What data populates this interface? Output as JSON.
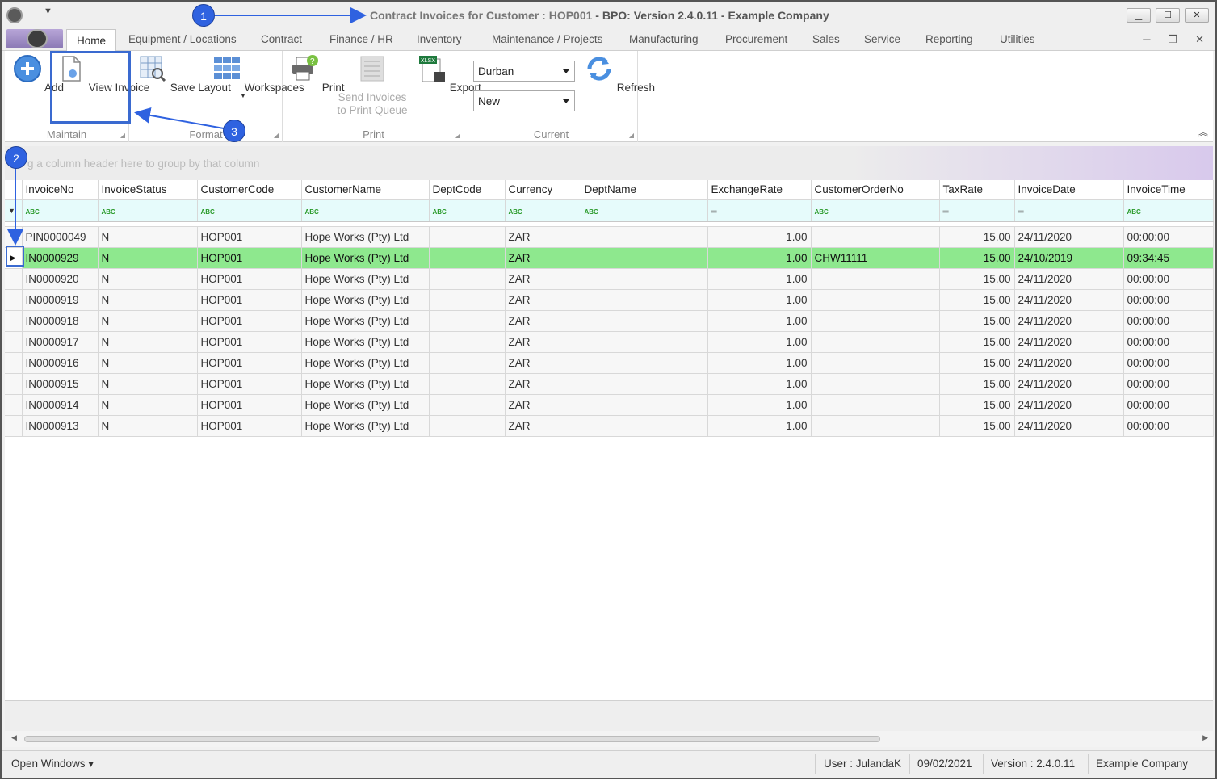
{
  "window": {
    "title_prefix": "Contract Invoices for Customer : HOP001",
    "title_suffix": " - BPO: Version 2.4.0.11 - Example Company",
    "minimize": "▁",
    "maximize": "☐",
    "close": "✕"
  },
  "tabs": [
    "Home",
    "Equipment / Locations",
    "Contract",
    "Finance / HR",
    "Inventory",
    "Maintenance / Projects",
    "Manufacturing",
    "Procurement",
    "Sales",
    "Service",
    "Reporting",
    "Utilities"
  ],
  "ribbon": {
    "maintain": {
      "label": "Maintain",
      "add": "Add",
      "view_invoice": "View Invoice"
    },
    "format": {
      "label": "Format",
      "save_layout": "Save Layout",
      "workspaces": "Workspaces"
    },
    "print": {
      "label": "Print",
      "print": "Print",
      "send_line1": "Send Invoices",
      "send_line2": "to Print Queue",
      "export": "Export"
    },
    "current": {
      "label": "Current",
      "site": "Durban",
      "status": "New",
      "refresh": "Refresh"
    }
  },
  "group_panel_hint": "g a column header here to group by that column",
  "grid": {
    "columns": [
      "InvoiceNo",
      "InvoiceStatus",
      "CustomerCode",
      "CustomerName",
      "DeptCode",
      "Currency",
      "DeptName",
      "ExchangeRate",
      "CustomerOrderNo",
      "TaxRate",
      "InvoiceDate",
      "InvoiceTime"
    ],
    "rows": [
      [
        "PIN0000049",
        "N",
        "HOP001",
        "Hope Works (Pty) Ltd",
        "",
        "ZAR",
        "",
        "1.00",
        "",
        "15.00",
        "24/11/2020",
        "00:00:00"
      ],
      [
        "IN0000929",
        "N",
        "HOP001",
        "Hope Works (Pty) Ltd",
        "",
        "ZAR",
        "",
        "1.00",
        "CHW11111",
        "15.00",
        "24/10/2019",
        "09:34:45"
      ],
      [
        "IN0000920",
        "N",
        "HOP001",
        "Hope Works (Pty) Ltd",
        "",
        "ZAR",
        "",
        "1.00",
        "",
        "15.00",
        "24/11/2020",
        "00:00:00"
      ],
      [
        "IN0000919",
        "N",
        "HOP001",
        "Hope Works (Pty) Ltd",
        "",
        "ZAR",
        "",
        "1.00",
        "",
        "15.00",
        "24/11/2020",
        "00:00:00"
      ],
      [
        "IN0000918",
        "N",
        "HOP001",
        "Hope Works (Pty) Ltd",
        "",
        "ZAR",
        "",
        "1.00",
        "",
        "15.00",
        "24/11/2020",
        "00:00:00"
      ],
      [
        "IN0000917",
        "N",
        "HOP001",
        "Hope Works (Pty) Ltd",
        "",
        "ZAR",
        "",
        "1.00",
        "",
        "15.00",
        "24/11/2020",
        "00:00:00"
      ],
      [
        "IN0000916",
        "N",
        "HOP001",
        "Hope Works (Pty) Ltd",
        "",
        "ZAR",
        "",
        "1.00",
        "",
        "15.00",
        "24/11/2020",
        "00:00:00"
      ],
      [
        "IN0000915",
        "N",
        "HOP001",
        "Hope Works (Pty) Ltd",
        "",
        "ZAR",
        "",
        "1.00",
        "",
        "15.00",
        "24/11/2020",
        "00:00:00"
      ],
      [
        "IN0000914",
        "N",
        "HOP001",
        "Hope Works (Pty) Ltd",
        "",
        "ZAR",
        "",
        "1.00",
        "",
        "15.00",
        "24/11/2020",
        "00:00:00"
      ],
      [
        "IN0000913",
        "N",
        "HOP001",
        "Hope Works (Pty) Ltd",
        "",
        "ZAR",
        "",
        "1.00",
        "",
        "15.00",
        "24/11/2020",
        "00:00:00"
      ]
    ],
    "selected_row": 1,
    "selected_color": "#8ee88e"
  },
  "status": {
    "open_windows": "Open Windows ▾",
    "user": "User : JulandaK",
    "date": "09/02/2021",
    "version": "Version : 2.4.0.11",
    "company": "Example Company"
  },
  "annotations": [
    "1",
    "2",
    "3"
  ],
  "accent_color": "#2f62e0"
}
